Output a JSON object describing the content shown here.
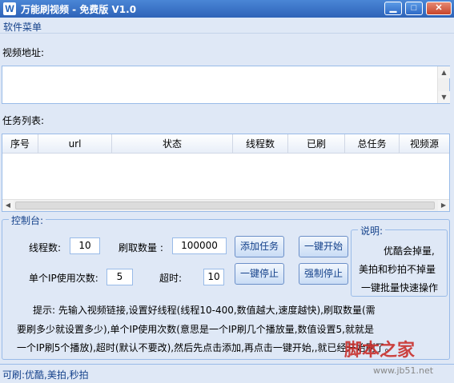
{
  "title": {
    "app_icon": "W",
    "text": "万能刷视频 - 免费版 V1.0",
    "minimize": "▁",
    "maximize": "□",
    "close": "✕"
  },
  "menu": {
    "software_menu": "软件菜单"
  },
  "video_address": {
    "label": "视频地址:",
    "value": ""
  },
  "task_list": {
    "label": "任务列表:",
    "columns": [
      "序号",
      "url",
      "状态",
      "线程数",
      "已刷",
      "总任务",
      "视频源"
    ],
    "rows": []
  },
  "control": {
    "legend": "控制台:",
    "threads_label": "线程数:",
    "threads_value": "10",
    "count_label": "刷取数量 :",
    "count_value": "100000",
    "per_ip_label": "单个IP使用次数:",
    "per_ip_value": "5",
    "timeout_label": "超时:",
    "timeout_value": "10",
    "add_task": "添加任务",
    "start_all": "一键开始",
    "stop_all": "一键停止",
    "force_stop": "强制停止",
    "explain_legend": "说明:",
    "explain_lines": [
      "优酷会掉量,",
      "美拍和秒拍不掉量",
      "一键批量快速操作"
    ],
    "tips": [
      "提示: 先输入视频链接,设置好线程(线程10-400,数值越大,速度越快),刷取数量(需",
      "要刷多少就设置多少),单个IP使用次数(意思是一个IP刷几个播放量,数值设置5,就就是",
      "一个IP刷5个播放),超时(默认不要改),然后先点击添加,再点击一键开始,,就已经开始刷了。"
    ]
  },
  "status": {
    "text": "可刷:优酷,美拍,秒拍"
  },
  "watermark": {
    "text": "脚本之家",
    "url": "www.jb51.net"
  }
}
